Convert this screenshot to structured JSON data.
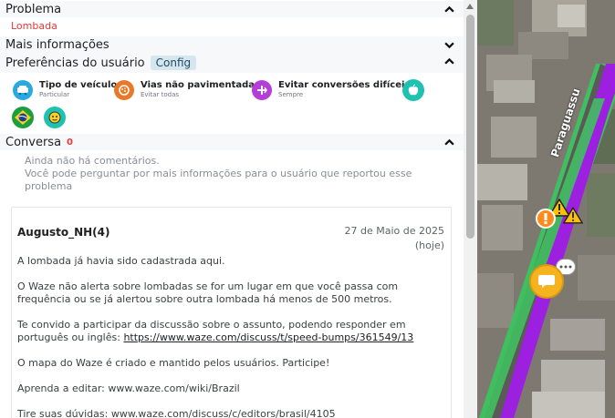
{
  "problem": {
    "header": "Problema",
    "value": "Lombada"
  },
  "more_info": {
    "header": "Mais informações"
  },
  "preferences": {
    "header": "Preferências do usuário",
    "config_button": "Config",
    "items": [
      {
        "title": "Tipo de veículo",
        "subtitle": "Particular"
      },
      {
        "title": "Vias não pavimentadas",
        "subtitle": "Evitar todas"
      },
      {
        "title": "Evitar conversões difíceis",
        "subtitle": "Sempre"
      }
    ]
  },
  "conversation": {
    "header": "Conversa",
    "count": "0",
    "empty_line1": "Ainda não há comentários.",
    "empty_line2": "Você pode perguntar por mais informações para o usuário que reportou esse",
    "empty_line3": "problema"
  },
  "comment": {
    "author": "Augusto_NH(4)",
    "date": "27 de Maio de 2025",
    "relative": "(hoje)",
    "p1": "A lombada já havia sido cadastrada aqui.",
    "p2a": "O Waze não alerta sobre lombadas se for um lugar em que você passa com",
    "p2b": "frequência ou se já alertou sobre outra lombada há menos de 500 metros.",
    "p3a": "Te convido a participar da discussão sobre o assunto, podendo responder em",
    "p3b_prefix": "português ou inglês: ",
    "p3b_link": "https://www.waze.com/discuss/t/speed-bumps/361549/13",
    "p4": "O mapa do Waze é criado e mantido pelos usuários. Participe!",
    "p5": "Aprenda a editar: www.waze.com/wiki/Brazil",
    "p6": "Tire suas dúvidas: www.waze.com/discuss/c/editors/brasil/4105"
  },
  "map": {
    "street_label": "Paraguassu"
  },
  "colors": {
    "accent_red": "#e53935",
    "route_purple": "#9d1fe0",
    "road_green": "#3fbf5f",
    "link_blue": "#202124"
  }
}
